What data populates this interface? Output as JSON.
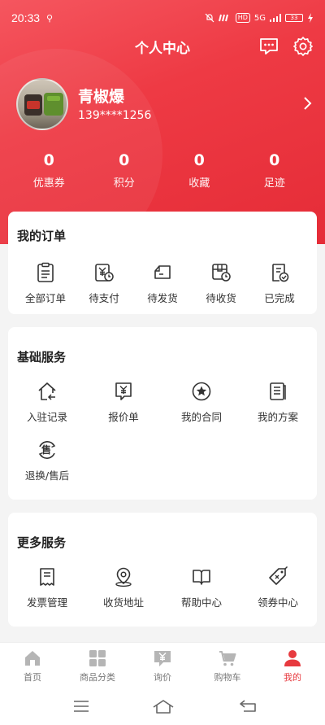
{
  "status_bar": {
    "time": "20:33",
    "network": "5G",
    "hd": "HD",
    "battery": "33"
  },
  "header": {
    "title": "个人中心"
  },
  "profile": {
    "name": "青椒爆",
    "phone": "139****1256"
  },
  "stats": [
    {
      "value": "0",
      "label": "优惠券"
    },
    {
      "value": "0",
      "label": "积分"
    },
    {
      "value": "0",
      "label": "收藏"
    },
    {
      "value": "0",
      "label": "足迹"
    }
  ],
  "orders": {
    "title": "我的订单",
    "items": [
      {
        "label": "全部订单",
        "icon": "clipboard-list-icon"
      },
      {
        "label": "待支付",
        "icon": "yen-wallet-icon"
      },
      {
        "label": "待发货",
        "icon": "truck-icon"
      },
      {
        "label": "待收货",
        "icon": "package-clock-icon"
      },
      {
        "label": "已完成",
        "icon": "document-check-icon"
      }
    ]
  },
  "basic_services": {
    "title": "基础服务",
    "items": [
      {
        "label": "入驻记录",
        "icon": "house-arrow-icon"
      },
      {
        "label": "报价单",
        "icon": "yen-message-icon"
      },
      {
        "label": "我的合同",
        "icon": "star-circle-icon"
      },
      {
        "label": "我的方案",
        "icon": "document-stack-icon"
      },
      {
        "label": "退换/售后",
        "icon": "after-sale-icon",
        "badge": "售"
      }
    ]
  },
  "more_services": {
    "title": "更多服务",
    "items": [
      {
        "label": "发票管理",
        "icon": "receipt-icon"
      },
      {
        "label": "收货地址",
        "icon": "location-pin-icon"
      },
      {
        "label": "帮助中心",
        "icon": "book-icon"
      },
      {
        "label": "领券中心",
        "icon": "coupon-tag-icon"
      }
    ]
  },
  "tabbar": {
    "items": [
      {
        "label": "首页",
        "icon": "home-icon",
        "active": false
      },
      {
        "label": "商品分类",
        "icon": "category-grid-icon",
        "active": false
      },
      {
        "label": "询价",
        "icon": "inquiry-icon",
        "active": false
      },
      {
        "label": "购物车",
        "icon": "cart-icon",
        "active": false
      },
      {
        "label": "我的",
        "icon": "person-icon",
        "active": true
      }
    ]
  },
  "colors": {
    "brand": "#e73a3f",
    "tab_inactive": "#b5b5b5"
  }
}
